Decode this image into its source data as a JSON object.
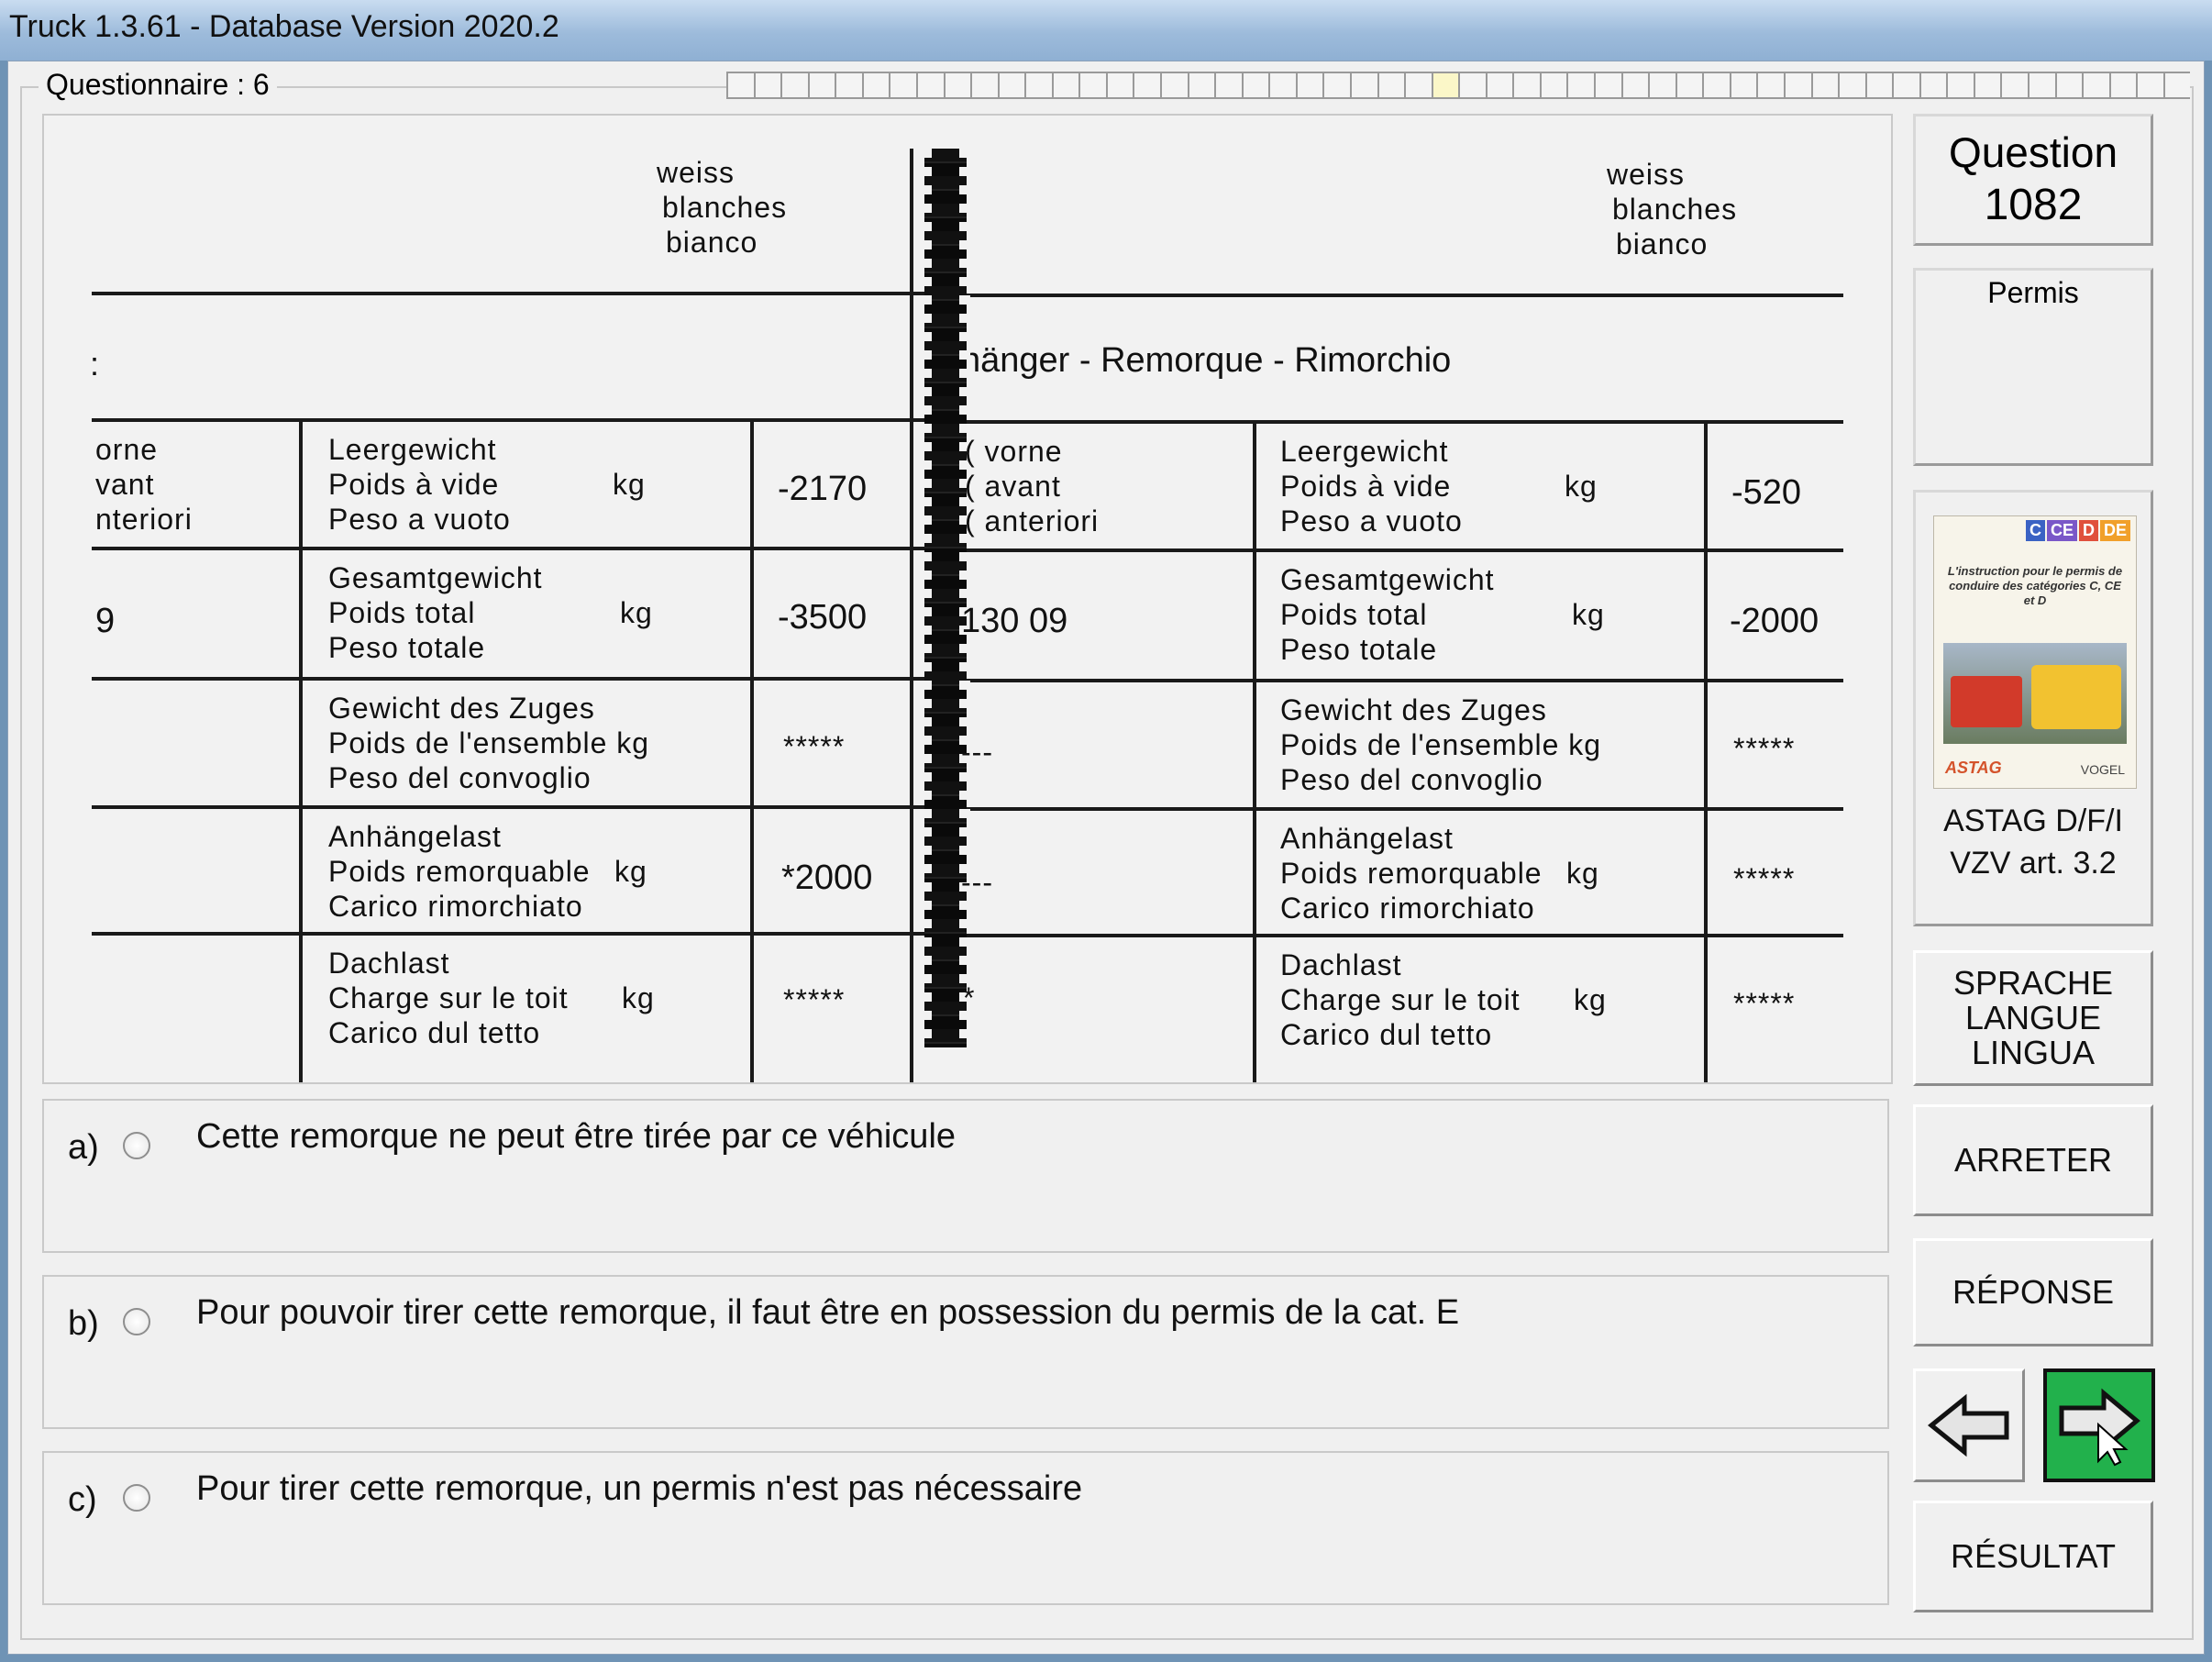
{
  "window": {
    "title": "Truck 1.3.61 - Database Version 2020.2"
  },
  "questionnaire": {
    "label": "Questionnaire : 6"
  },
  "figure": {
    "header_colors": [
      "weiss",
      "blanches",
      "bianco"
    ],
    "left_truncated": ":",
    "right_title": "hänger  - Remorque  -  Rimorchio",
    "rows": [
      {
        "left_frag": [
          "orne",
          "vant",
          "nteriori"
        ],
        "labels": [
          "Leergewicht",
          "Poids à vide",
          "Peso a vuoto"
        ],
        "unit": "kg",
        "left_value": "-2170",
        "right_frag": [
          "(     vorne",
          "(    avant",
          "(     anteriori"
        ],
        "right_value": "-520"
      },
      {
        "left_frag": [
          "9"
        ],
        "labels": [
          "Gesamtgewicht",
          "Poids total",
          "Peso totale"
        ],
        "unit": "kg",
        "left_value": "-3500",
        "right_frag": [
          "130 09"
        ],
        "right_value": "-2000"
      },
      {
        "left_frag": [
          ""
        ],
        "labels": [
          "Gewicht des Zuges",
          "Poids de l'ensemble kg",
          "Peso del convoglio"
        ],
        "unit": "",
        "left_value": "*****",
        "right_frag": [
          "---"
        ],
        "right_value": "*****"
      },
      {
        "left_frag": [
          ""
        ],
        "labels": [
          "Anhängelast",
          "Poids remorquable",
          "Carico rimorchiato"
        ],
        "unit": "kg",
        "left_value": "*2000",
        "right_frag": [
          "---"
        ],
        "right_value": "*****"
      },
      {
        "left_frag": [
          ""
        ],
        "labels": [
          "Dachlast",
          "Charge sur le toit",
          "Carico dul tetto"
        ],
        "unit": "kg",
        "left_value": "*****",
        "right_frag": [
          "*"
        ],
        "right_value": "*****"
      }
    ]
  },
  "answers": [
    {
      "letter": "a)",
      "text": "Cette remorque ne peut être tirée par ce véhicule"
    },
    {
      "letter": "b)",
      "text": "Pour pouvoir tirer cette remorque, il faut être en possession du permis de la cat. E"
    },
    {
      "letter": "c)",
      "text": "Pour tirer cette remorque, un permis n'est pas nécessaire"
    }
  ],
  "sidebar": {
    "question_label": "Question",
    "question_number": "1082",
    "category": "Permis",
    "book": {
      "badges": [
        "C",
        "CE",
        "D",
        "DE"
      ],
      "text": "L'instruction pour le permis de conduire des catégories C, CE et D",
      "publisher_left": "ASTAG",
      "publisher_right": "VOGEL"
    },
    "source_line1": "ASTAG D/F/I",
    "source_line2": "VZV art. 3.2",
    "language_button": [
      "SPRACHE",
      "LANGUE",
      "LINGUA"
    ],
    "stop_button": "ARRETER",
    "answer_button": "RÉPONSE",
    "result_button": "RÉSULTAT"
  },
  "progress": {
    "total_cells": 54,
    "current_cell": 26
  },
  "colors": {
    "next_button": "#22b14c",
    "titlebar": "#9dbbdb"
  }
}
